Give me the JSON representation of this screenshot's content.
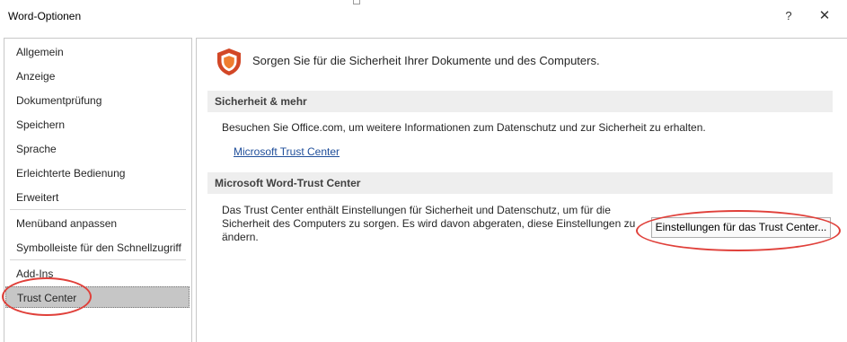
{
  "window": {
    "title": "Word-Optionen",
    "help_label": "?",
    "close_label": "✕"
  },
  "sidebar": {
    "items": [
      {
        "label": "Allgemein"
      },
      {
        "label": "Anzeige"
      },
      {
        "label": "Dokumentprüfung"
      },
      {
        "label": "Speichern"
      },
      {
        "label": "Sprache"
      },
      {
        "label": "Erleichterte Bedienung"
      },
      {
        "label": "Erweitert"
      },
      {
        "label": "Menüband anpassen"
      },
      {
        "label": "Symbolleiste für den Schnellzugriff"
      },
      {
        "label": "Add-Ins"
      },
      {
        "label": "Trust Center"
      }
    ],
    "selected": "Trust Center"
  },
  "main": {
    "heading": "Sorgen Sie für die Sicherheit Ihrer Dokumente und des Computers.",
    "section1": {
      "title": "Sicherheit & mehr",
      "text": "Besuchen Sie Office.com, um weitere Informationen zum Datenschutz und zur Sicherheit zu erhalten.",
      "link": "Microsoft Trust Center"
    },
    "section2": {
      "title": "Microsoft Word-Trust Center",
      "text_lines": [
        "Das Trust Center enthält Einstellungen für Sicherheit und Datenschutz, um für die",
        "Sicherheit des Computers zu sorgen. Es wird davon abgeraten, diese Einstellungen zu",
        "ändern."
      ],
      "button": "Einstellungen für das Trust Center..."
    }
  },
  "colors": {
    "accent": "#d24726",
    "annotation": "#e0403a",
    "link": "#1f4e9a",
    "selected_bg": "#c6c6c6",
    "section_bg": "#eeeeee"
  },
  "icons": {
    "heading_icon": "shield-icon",
    "help": "help-icon",
    "close": "close-icon"
  }
}
